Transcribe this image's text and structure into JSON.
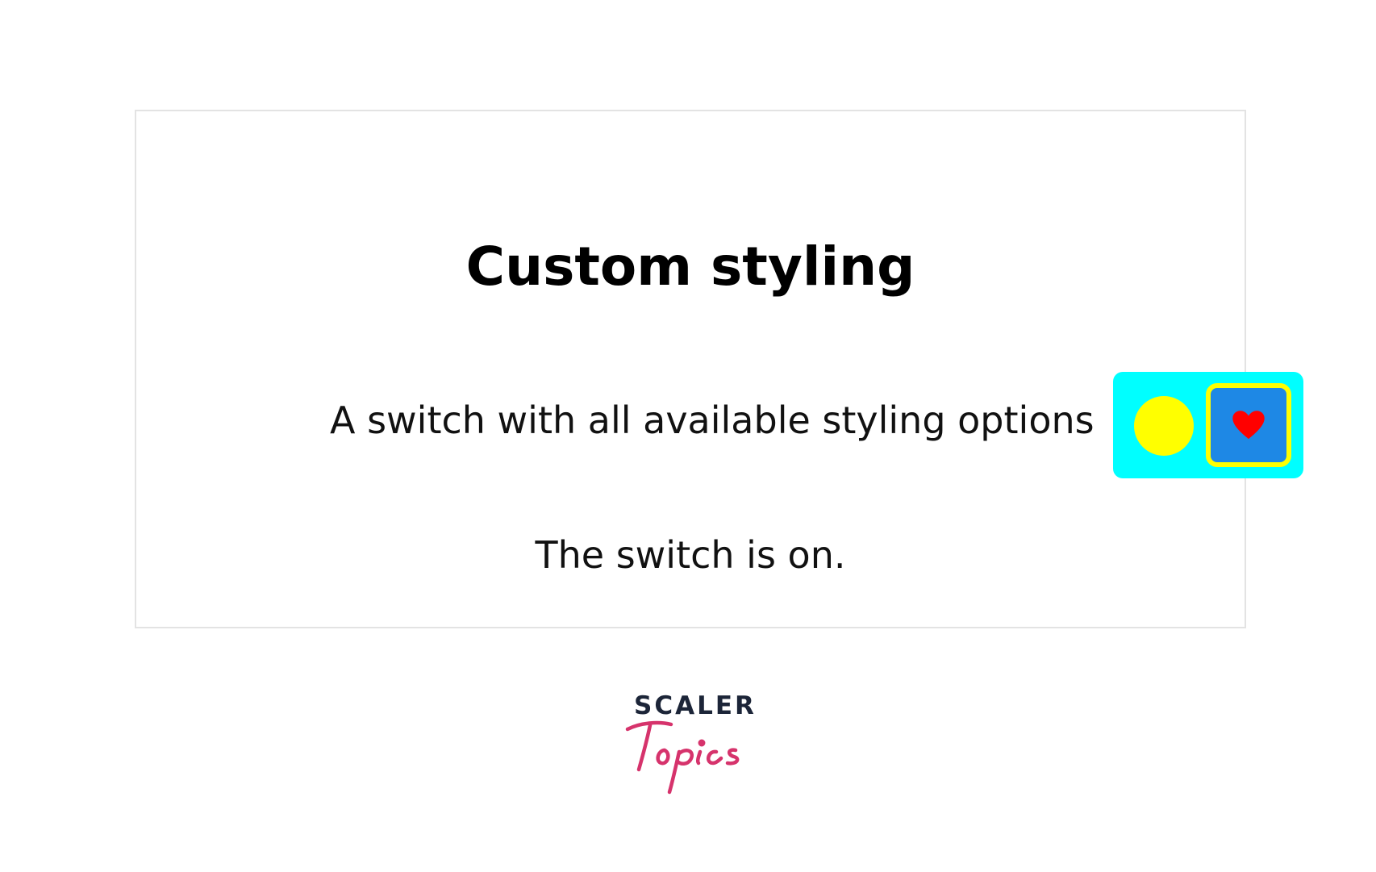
{
  "card": {
    "title": "Custom styling",
    "switch_label": "A switch with all available styling options",
    "status_text": "The switch is on."
  },
  "switch": {
    "state": "on",
    "thumb_icon": "heart-icon",
    "colors": {
      "track": "#00ffff",
      "off_indicator": "#ffff00",
      "thumb_fill": "#1e88e5",
      "thumb_border": "#ffff00",
      "heart": "#ff0000"
    }
  },
  "logo": {
    "scaler": "SCALER",
    "topics": "Topics",
    "colors": {
      "scaler": "#1c2538",
      "topics": "#d6336c"
    }
  }
}
